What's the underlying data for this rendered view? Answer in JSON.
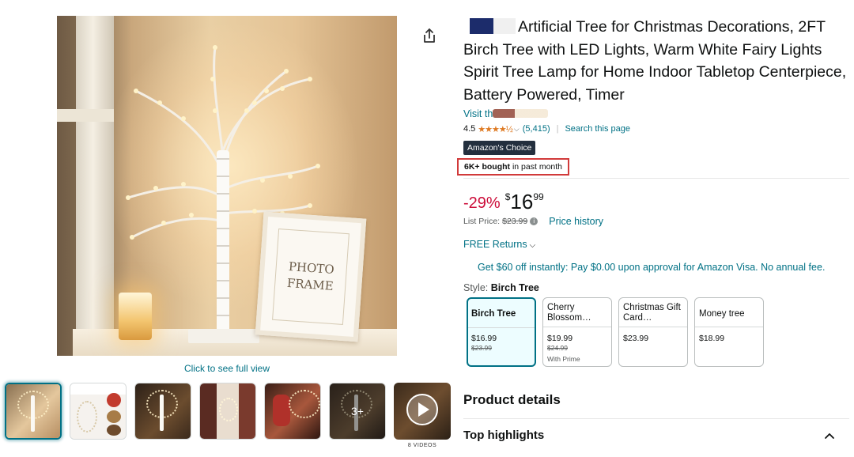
{
  "product": {
    "title": "Artificial Tree for Christmas Decorations, 2FT Birch Tree with LED Lights, Warm White Fairy Lights Spirit Tree Lamp for Home Indoor Tabletop Centerpiece, Battery Powered, Timer",
    "visit_store_prefix": "Visit th",
    "rating": "4.5",
    "stars": "★★★★½",
    "ratings_count": "(5,415)",
    "search_page": "Search this page",
    "badge": "Amazon's Choice",
    "bought_bold": "6K+ bought",
    "bought_rest": " in past month"
  },
  "pricing": {
    "discount": "-29%",
    "currency": "$",
    "whole": "16",
    "fraction": "99",
    "list_label": "List Price:",
    "list_price": "$23.99",
    "info_symbol": "i",
    "price_history": "Price history",
    "returns": "FREE Returns",
    "visa_offer": "Get $60 off instantly: Pay $0.00 upon approval for Amazon Visa. No annual fee."
  },
  "style": {
    "label": "Style:",
    "selected": "Birch Tree",
    "options": [
      {
        "name": "Birch Tree",
        "price": "$16.99",
        "old": "$23.99",
        "note": ""
      },
      {
        "name": "Cherry Blossom…",
        "price": "$19.99",
        "old": "$24.99",
        "note": "With Prime"
      },
      {
        "name": "Christmas Gift Card…",
        "price": "$23.99",
        "old": "",
        "note": ""
      },
      {
        "name": "Money tree",
        "price": "$18.99",
        "old": "",
        "note": ""
      }
    ]
  },
  "media": {
    "photo_frame_text": "PHOTO FRAME",
    "click_full": "Click to see full view",
    "more_count": "3+",
    "videos_label": "8 VIDEOS"
  },
  "sections": {
    "product_details": "Product details",
    "top_highlights": "Top highlights"
  },
  "colors": {
    "link": "#007185",
    "discount": "#cc0c39",
    "star": "#de7921",
    "badge_bg": "#232f3e",
    "highlight_box": "#d13a3a"
  }
}
